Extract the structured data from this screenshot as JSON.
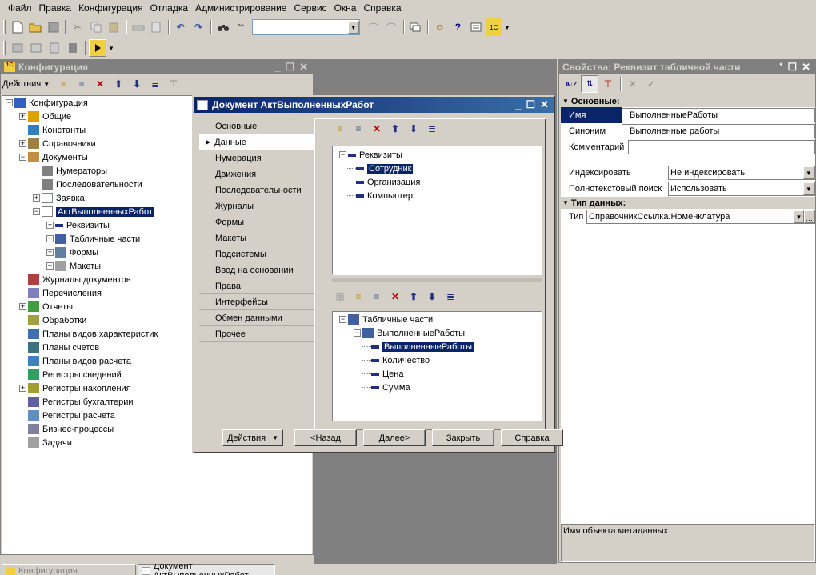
{
  "menu": [
    "Файл",
    "Правка",
    "Конфигурация",
    "Отладка",
    "Администрирование",
    "Сервис",
    "Окна",
    "Справка"
  ],
  "toolbar": {
    "search_value": "",
    "icons": [
      "new-icon",
      "open-icon",
      "save-icon",
      "cut-icon",
      "copy-icon",
      "paste-icon",
      "print-icon",
      "preview-icon",
      "undo-icon",
      "redo-icon",
      "find-icon",
      "find-next-icon"
    ]
  },
  "config_window": {
    "title": "Конфигурация",
    "actions_label": "Действия",
    "tree": [
      {
        "label": "Конфигурация",
        "level": 0,
        "exp": "-",
        "icon": "config"
      },
      {
        "label": "Общие",
        "level": 1,
        "exp": "+",
        "icon": "common"
      },
      {
        "label": "Константы",
        "level": 1,
        "exp": "",
        "icon": "const"
      },
      {
        "label": "Справочники",
        "level": 1,
        "exp": "+",
        "icon": "catalog"
      },
      {
        "label": "Документы",
        "level": 1,
        "exp": "-",
        "icon": "docs"
      },
      {
        "label": "Нумераторы",
        "level": 2,
        "exp": "",
        "icon": "numer"
      },
      {
        "label": "Последовательности",
        "level": 2,
        "exp": "",
        "icon": "seq"
      },
      {
        "label": "Заявка",
        "level": 2,
        "exp": "+",
        "icon": "doc"
      },
      {
        "label": "АктВыполненныхРабот",
        "level": 2,
        "exp": "-",
        "icon": "doc",
        "selected": true
      },
      {
        "label": "Реквизиты",
        "level": 3,
        "exp": "+",
        "icon": "attr"
      },
      {
        "label": "Табличные части",
        "level": 3,
        "exp": "+",
        "icon": "table"
      },
      {
        "label": "Формы",
        "level": 3,
        "exp": "+",
        "icon": "form"
      },
      {
        "label": "Макеты",
        "level": 3,
        "exp": "+",
        "icon": "layout"
      },
      {
        "label": "Журналы документов",
        "level": 1,
        "exp": "",
        "icon": "journal"
      },
      {
        "label": "Перечисления",
        "level": 1,
        "exp": "",
        "icon": "enum"
      },
      {
        "label": "Отчеты",
        "level": 1,
        "exp": "+",
        "icon": "report"
      },
      {
        "label": "Обработки",
        "level": 1,
        "exp": "",
        "icon": "proc"
      },
      {
        "label": "Планы видов характеристик",
        "level": 1,
        "exp": "",
        "icon": "pvh"
      },
      {
        "label": "Планы счетов",
        "level": 1,
        "exp": "",
        "icon": "accounts"
      },
      {
        "label": "Планы видов расчета",
        "level": 1,
        "exp": "",
        "icon": "calc"
      },
      {
        "label": "Регистры сведений",
        "level": 1,
        "exp": "",
        "icon": "reginfo"
      },
      {
        "label": "Регистры накопления",
        "level": 1,
        "exp": "+",
        "icon": "regacc"
      },
      {
        "label": "Регистры бухгалтерии",
        "level": 1,
        "exp": "",
        "icon": "regbuh"
      },
      {
        "label": "Регистры расчета",
        "level": 1,
        "exp": "",
        "icon": "regcalc"
      },
      {
        "label": "Бизнес-процессы",
        "level": 1,
        "exp": "",
        "icon": "bp"
      },
      {
        "label": "Задачи",
        "level": 1,
        "exp": "",
        "icon": "task"
      }
    ]
  },
  "doc_window": {
    "title": "Документ АктВыполненныхРабот",
    "tabs": [
      "Основные",
      "Данные",
      "Нумерация",
      "Движения",
      "Последовательности",
      "Журналы",
      "Формы",
      "Макеты",
      "Подсистемы",
      "Ввод на основании",
      "Права",
      "Интерфейсы",
      "Обмен данными",
      "Прочее"
    ],
    "active_tab": 1,
    "attrs_tree": {
      "root": "Реквизиты",
      "items": [
        "Сотрудник",
        "Организация",
        "Компьютер"
      ],
      "selected": 0
    },
    "tables_tree": {
      "root": "Табличные части",
      "table": "ВыполненныеРаботы",
      "items": [
        "ВыполненныеРаботы",
        "Количество",
        "Цена",
        "Сумма"
      ],
      "selected": 0
    },
    "buttons": {
      "actions": "Действия",
      "back": "<Назад",
      "next": "Далее>",
      "close": "Закрыть",
      "help": "Справка"
    }
  },
  "props": {
    "title": "Свойства: Реквизит табличной части",
    "section_main": "Основные:",
    "name_label": "Имя",
    "name_value": "ВыполненныеРаботы",
    "synonym_label": "Синоним",
    "synonym_value": "Выполненные работы",
    "comment_label": "Комментарий",
    "comment_value": "",
    "index_label": "Индексировать",
    "index_value": "Не индексировать",
    "fts_label": "Полнотекстовый поиск",
    "fts_value": "Использовать",
    "section_type": "Тип данных:",
    "type_label": "Тип",
    "type_value": "СправочникСсылка.Номенклатура",
    "hint": "Имя объекта метаданных"
  },
  "taskbar": [
    "Конфигурация",
    "Документ АктВыполненныхРабот"
  ],
  "colors": {
    "active_title": "#0a246a",
    "mdi_bg": "#808080",
    "selection": "#0a246a"
  }
}
